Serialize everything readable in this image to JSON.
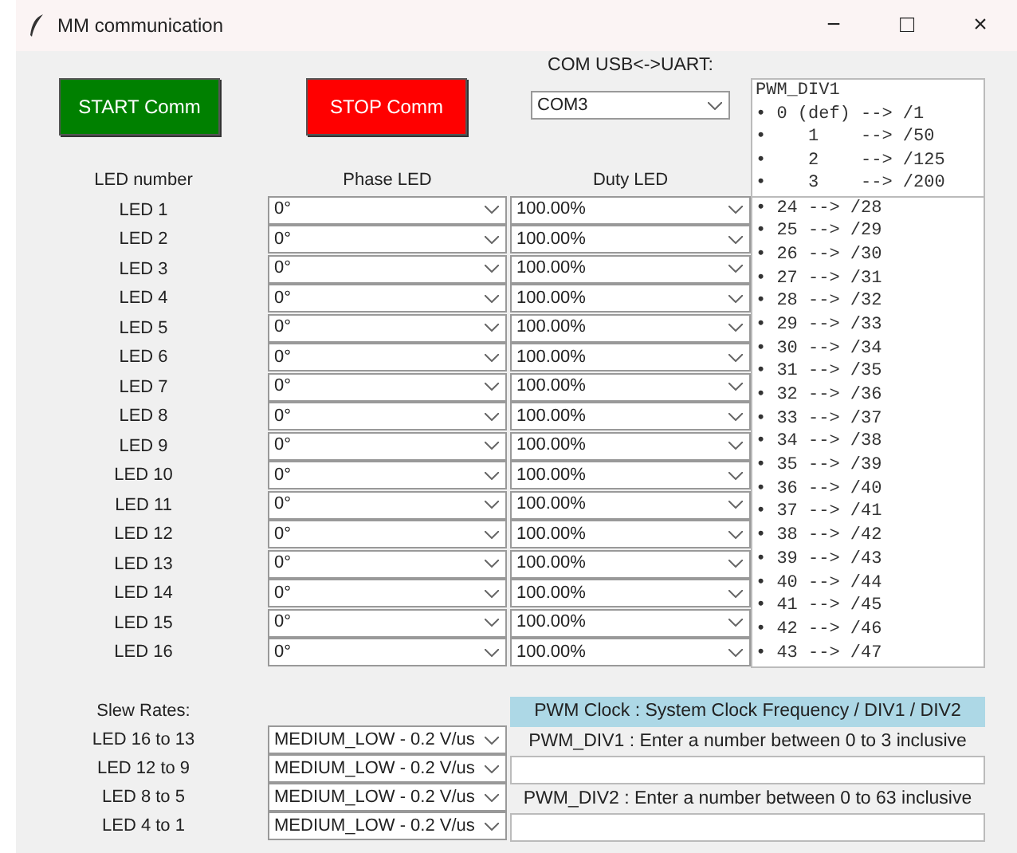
{
  "window": {
    "title": "MM communication",
    "controls": [
      "−",
      "□",
      "×"
    ]
  },
  "buttons": [
    {
      "label": "START Comm",
      "kind": "start"
    },
    {
      "label": "STOP Comm",
      "kind": "stop"
    }
  ],
  "com": {
    "label": "COM USB<->UART:",
    "value": "COM3"
  },
  "div1_list": {
    "title": "PWM_DIV1",
    "items": [
      {
        "bullet": "•",
        "text": "0 (def) --> /1"
      },
      {
        "bullet": "•",
        "text": "   1    --> /50"
      },
      {
        "bullet": "•",
        "text": "   2    --> /125"
      },
      {
        "bullet": "•",
        "text": "   3    --> /200"
      }
    ]
  },
  "columns": [
    "LED number",
    "Phase LED",
    "Duty LED"
  ],
  "leds": [
    {
      "label": "LED 1",
      "phase": "0°",
      "duty": "100.00%"
    },
    {
      "label": "LED 2",
      "phase": "0°",
      "duty": "100.00%"
    },
    {
      "label": "LED 3",
      "phase": "0°",
      "duty": "100.00%"
    },
    {
      "label": "LED 4",
      "phase": "0°",
      "duty": "100.00%"
    },
    {
      "label": "LED 5",
      "phase": "0°",
      "duty": "100.00%"
    },
    {
      "label": "LED 6",
      "phase": "0°",
      "duty": "100.00%"
    },
    {
      "label": "LED 7",
      "phase": "0°",
      "duty": "100.00%"
    },
    {
      "label": "LED 8",
      "phase": "0°",
      "duty": "100.00%"
    },
    {
      "label": "LED 9",
      "phase": "0°",
      "duty": "100.00%"
    },
    {
      "label": "LED 10",
      "phase": "0°",
      "duty": "100.00%"
    },
    {
      "label": "LED 11",
      "phase": "0°",
      "duty": "100.00%"
    },
    {
      "label": "LED 12",
      "phase": "0°",
      "duty": "100.00%"
    },
    {
      "label": "LED 13",
      "phase": "0°",
      "duty": "100.00%"
    },
    {
      "label": "LED 14",
      "phase": "0°",
      "duty": "100.00%"
    },
    {
      "label": "LED 15",
      "phase": "0°",
      "duty": "100.00%"
    },
    {
      "label": "LED 16",
      "phase": "0°",
      "duty": "100.00%"
    }
  ],
  "div2_list": {
    "items": [
      {
        "bullet": "•",
        "text": "24 --> /28"
      },
      {
        "bullet": "•",
        "text": "25 --> /29"
      },
      {
        "bullet": "•",
        "text": "26 --> /30"
      },
      {
        "bullet": "•",
        "text": "27 --> /31"
      },
      {
        "bullet": "•",
        "text": "28 --> /32"
      },
      {
        "bullet": "•",
        "text": "29 --> /33"
      },
      {
        "bullet": "•",
        "text": "30 --> /34"
      },
      {
        "bullet": "•",
        "text": "31 --> /35"
      },
      {
        "bullet": "•",
        "text": "32 --> /36"
      },
      {
        "bullet": "•",
        "text": "33 --> /37"
      },
      {
        "bullet": "•",
        "text": "34 --> /38"
      },
      {
        "bullet": "•",
        "text": "35 --> /39"
      },
      {
        "bullet": "•",
        "text": "36 --> /40"
      },
      {
        "bullet": "•",
        "text": "37 --> /41"
      },
      {
        "bullet": "•",
        "text": "38 --> /42"
      },
      {
        "bullet": "•",
        "text": "39 --> /43"
      },
      {
        "bullet": "•",
        "text": "40 --> /44"
      },
      {
        "bullet": "•",
        "text": "41 --> /45"
      },
      {
        "bullet": "•",
        "text": "42 --> /46"
      },
      {
        "bullet": "•",
        "text": "43 --> /47"
      }
    ]
  },
  "slew": {
    "title": "Slew Rates:",
    "rows": [
      {
        "label": "LED 16 to 13",
        "value": "MEDIUM_LOW - 0.2 V/us"
      },
      {
        "label": "LED 12 to 9",
        "value": "MEDIUM_LOW - 0.2 V/us"
      },
      {
        "label": "LED 8 to 5",
        "value": "MEDIUM_LOW - 0.2 V/us"
      },
      {
        "label": "LED 4 to 1",
        "value": "MEDIUM_LOW - 0.2 V/us"
      }
    ]
  },
  "pwm": {
    "header": "PWM Clock : System Clock Frequency / DIV1 / DIV2",
    "fields": [
      {
        "label": "PWM_DIV1 : Enter a number between 0 to 3 inclusive"
      },
      {
        "label": "PWM_DIV2 : Enter a number between 0 to 63 inclusive"
      }
    ]
  }
}
